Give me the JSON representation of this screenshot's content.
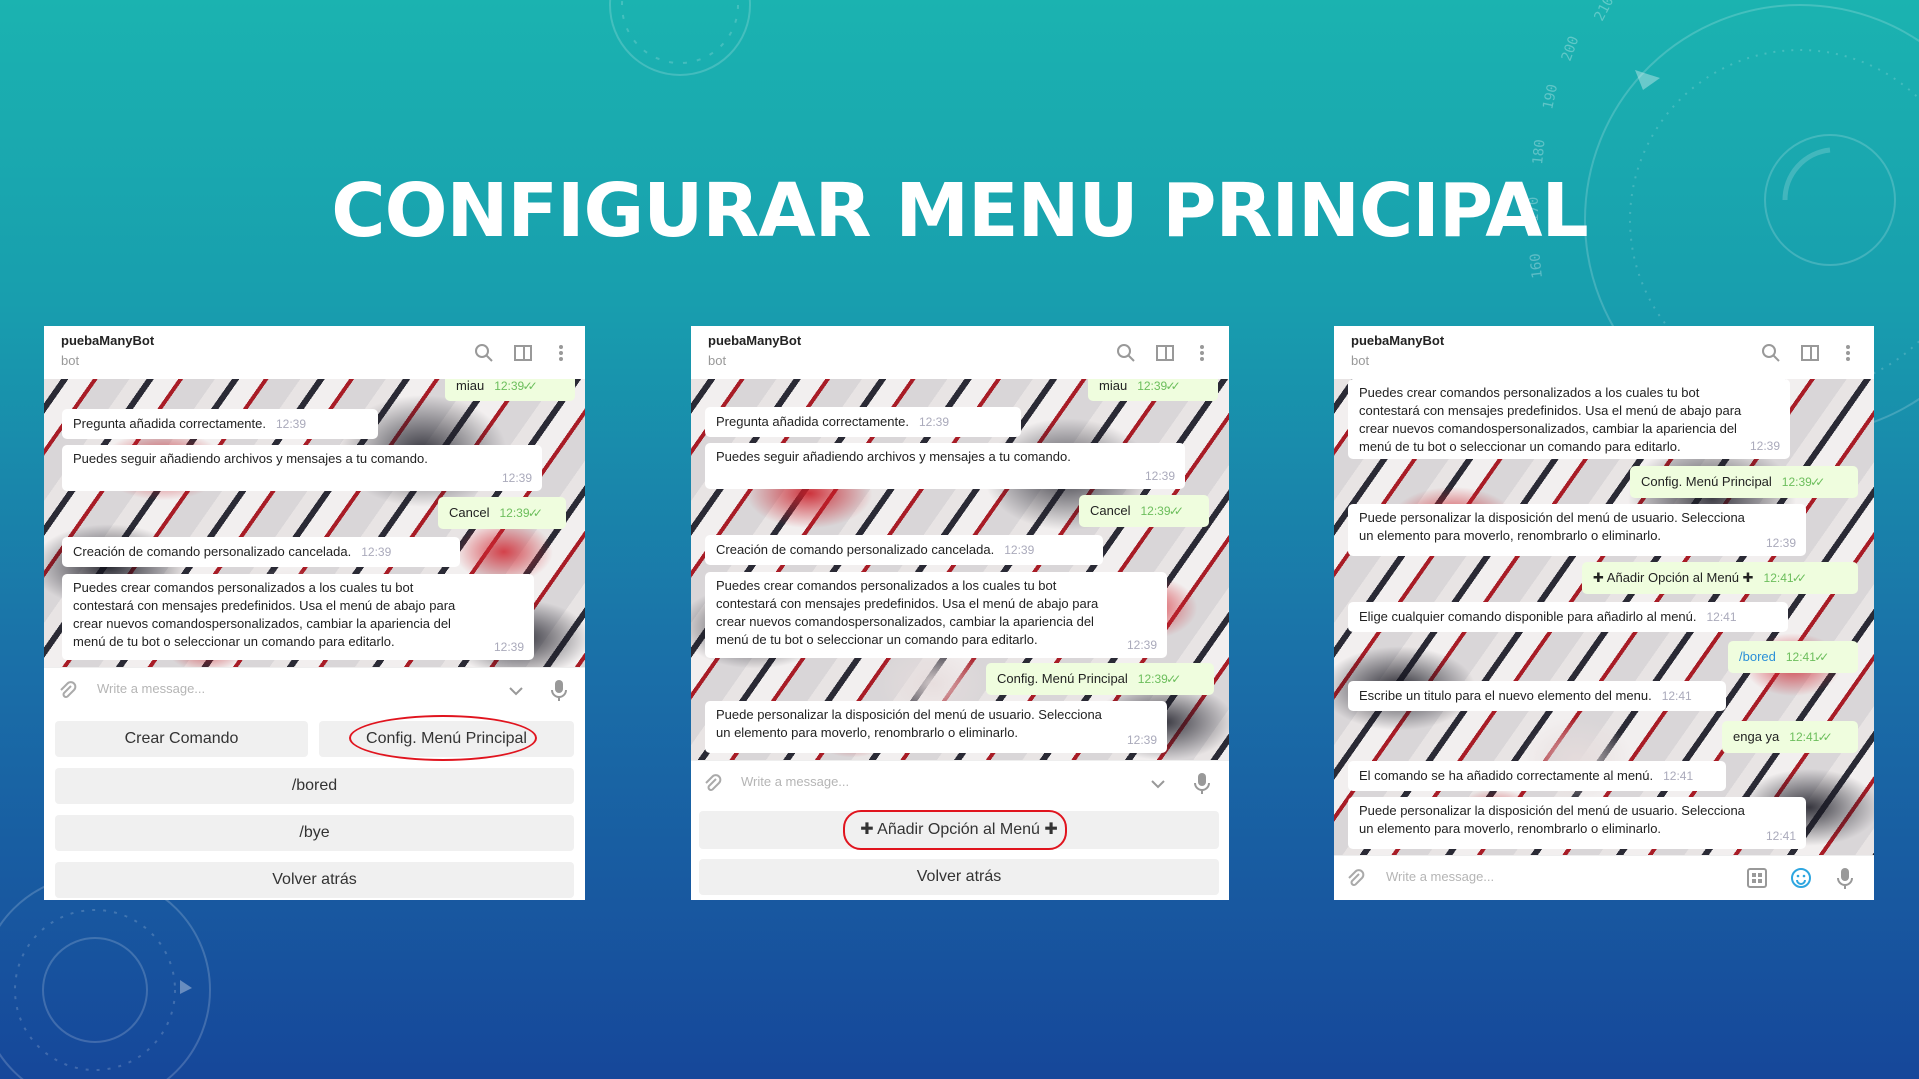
{
  "slide_title": "CONFIGURAR MENU PRINCIPAL",
  "deco_numbers": [
    "210",
    "200",
    "190",
    "180",
    "170",
    "160"
  ],
  "chat": {
    "name": "puebaManyBot",
    "status": "bot",
    "placeholder": "Write a message..."
  },
  "colors": {
    "incoming": "#ffffff",
    "outgoing": "#effdde",
    "time_out": "#6cbe5c",
    "highlight": "#e0141e"
  },
  "messages": {
    "miau": "miau",
    "pregunta": "Pregunta añadida correctamente.",
    "seguir": "Puedes seguir añadiendo archivos y mensajes a tu comando.",
    "cancel": "Cancel",
    "cancelada": "Creación de comando personalizado cancelada.",
    "puedes_crear": [
      "Puedes crear comandos personalizados a los cuales tu bot",
      "contestará con mensajes predefinidos. Usa el menú de abajo para",
      "crear nuevos comandospersonalizados, cambiar la apariencia del",
      "menú de tu bot o seleccionar un comando para editarlo."
    ],
    "config_menu": "Config. Menú Principal",
    "personalizar": [
      "Puede personalizar la disposición del menú de usuario. Selecciona",
      "un elemento para moverlo, renombrarlo o eliminarlo."
    ],
    "anadir_opcion": "✚ Añadir Opción al Menú ✚",
    "elige": "Elige cualquier comando disponible para añadirlo al menú.",
    "bored": "/bored",
    "titulo": "Escribe un titulo para el nuevo elemento del menu.",
    "enga": "enga ya",
    "anadido": "El comando se ha añadido correctamente al menú."
  },
  "times": {
    "t1239": "12:39",
    "t1241": "12:41"
  },
  "keyboard1": {
    "crear": "Crear Comando",
    "config": "Config. Menú Principal",
    "bored": "/bored",
    "bye": "/bye",
    "volver": "Volver atrás"
  },
  "keyboard2": {
    "anadir": "✚ Añadir Opción al Menú ✚",
    "volver": "Volver atrás"
  },
  "icons": [
    "search-icon",
    "columns-icon",
    "more-vert-icon",
    "paperclip-icon",
    "chevron-down-icon",
    "mic-icon",
    "keyboard-grid-icon",
    "emoji-icon",
    "double-check-icon"
  ]
}
